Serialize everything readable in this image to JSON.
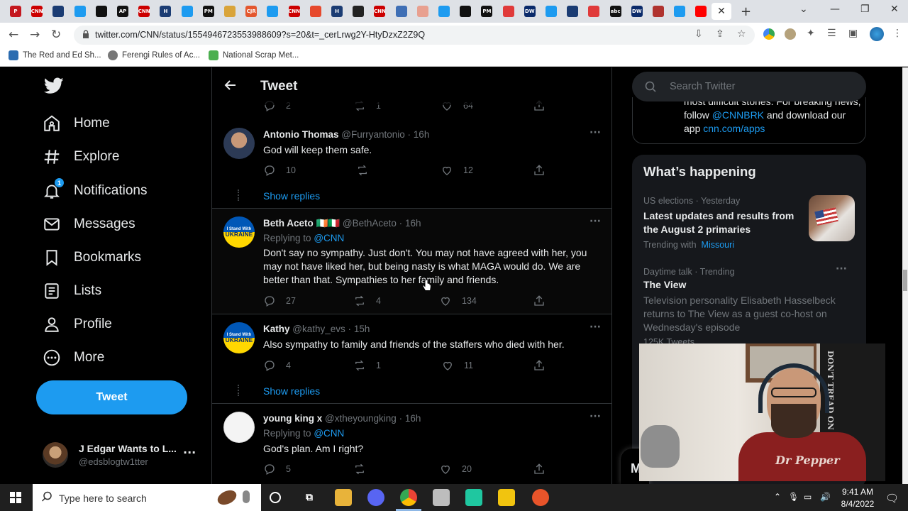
{
  "browser": {
    "url": "twitter.com/CNN/status/1554946723553988609?s=20&t=_cerLrwg2Y-HtyDzxZ2Z9Q",
    "tabs": [
      {
        "icon": "P",
        "color": "#c4181f"
      },
      {
        "icon": "CNN",
        "color": "#cc0000"
      },
      {
        "icon": "",
        "color": "#1b3c73"
      },
      {
        "icon": "",
        "color": "#1d9bf0"
      },
      {
        "icon": "",
        "color": "#111111"
      },
      {
        "icon": "AP",
        "color": "#111111"
      },
      {
        "icon": "CNN",
        "color": "#cc0000"
      },
      {
        "icon": "H",
        "color": "#1b3c73"
      },
      {
        "icon": "",
        "color": "#1d9bf0"
      },
      {
        "icon": "PM",
        "color": "#111111"
      },
      {
        "icon": "",
        "color": "#d9a43a"
      },
      {
        "icon": "CJR",
        "color": "#e4572e"
      },
      {
        "icon": "",
        "color": "#1d9bf0"
      },
      {
        "icon": "CNN",
        "color": "#cc0000"
      },
      {
        "icon": "",
        "color": "#e6492d"
      },
      {
        "icon": "H",
        "color": "#1b3c73"
      },
      {
        "icon": "",
        "color": "#222222"
      },
      {
        "icon": "CNN",
        "color": "#cc0000"
      },
      {
        "icon": "",
        "color": "#3f6fb5"
      },
      {
        "icon": "",
        "color": "#e8a090"
      },
      {
        "icon": "",
        "color": "#1d9bf0"
      },
      {
        "icon": "",
        "color": "#111111"
      },
      {
        "icon": "PM",
        "color": "#111111"
      },
      {
        "icon": "",
        "color": "#e03a3a"
      },
      {
        "icon": "DW",
        "color": "#0a2a6a"
      },
      {
        "icon": "",
        "color": "#1d9bf0"
      },
      {
        "icon": "",
        "color": "#1b3c73"
      },
      {
        "icon": "",
        "color": "#e03a3a"
      },
      {
        "icon": "abc",
        "color": "#111111"
      },
      {
        "icon": "DW",
        "color": "#0a2a6a"
      },
      {
        "icon": "",
        "color": "#b0332f"
      },
      {
        "icon": "",
        "color": "#1d9bf0"
      },
      {
        "icon": "",
        "color": "#ff0000"
      }
    ]
  },
  "bookmarks": [
    {
      "label": "The Red and Ed Sh...",
      "color": "#2b6cb0"
    },
    {
      "label": "Ferengi Rules of Ac...",
      "color": "#777777"
    },
    {
      "label": "National Scrap Met...",
      "color": "#4caf50"
    }
  ],
  "nav": {
    "items": [
      {
        "label": "Home",
        "icon": "home-icon"
      },
      {
        "label": "Explore",
        "icon": "hashtag-icon"
      },
      {
        "label": "Notifications",
        "icon": "bell-icon"
      },
      {
        "label": "Messages",
        "icon": "mail-icon"
      },
      {
        "label": "Bookmarks",
        "icon": "bookmark-icon"
      },
      {
        "label": "Lists",
        "icon": "list-icon"
      },
      {
        "label": "Profile",
        "icon": "person-icon"
      },
      {
        "label": "More",
        "icon": "more-circle-icon"
      }
    ],
    "notification_count": "1",
    "tweet_button": "Tweet",
    "account_name": "J Edgar Wants to L...",
    "account_handle": "@edsblogtw1tter"
  },
  "column": {
    "title": "Tweet",
    "top_stats": {
      "replies": "2",
      "retweets": "1",
      "likes": "64"
    }
  },
  "tweets": [
    {
      "name": "Antonio Thomas",
      "handle": "@Furryantonio",
      "time": "16h",
      "replying_to": "",
      "text": "God will keep them safe.",
      "replies": "10",
      "retweets": "",
      "likes": "12",
      "show_replies": "Show replies"
    },
    {
      "name": "Beth Aceto 🇮🇪🇮🇹",
      "handle": "@BethAceto",
      "time": "16h",
      "replying_to": "@CNN",
      "text": "Don't say no sympathy. Just don't. You may not have agreed with her, you may not have liked her, but being nasty is what MAGA would do. We are better than that. Sympathies to her family and friends.",
      "replies": "27",
      "retweets": "4",
      "likes": "134",
      "show_replies": ""
    },
    {
      "name": "Kathy",
      "handle": "@kathy_evs",
      "time": "15h",
      "replying_to": "",
      "text": "Also sympathy to family and friends of the staffers who died with her.",
      "replies": "4",
      "retweets": "1",
      "likes": "11",
      "show_replies": "Show replies"
    },
    {
      "name": "young king x",
      "handle": "@xtheyoungking",
      "time": "16h",
      "replying_to": "@CNN",
      "text": "God's plan. Am I right?",
      "replies": "5",
      "retweets": "",
      "likes": "20",
      "show_replies": ""
    }
  ],
  "replying_label": "Replying to",
  "ukraine_badge": {
    "line1": "I Stand With",
    "line2": "UKRAINE"
  },
  "right": {
    "search_placeholder": "Search Twitter",
    "promo": {
      "part1": "most difficult stories. For breaking news, follow",
      "link1": "@CNNBRK",
      "part2": "and download our app",
      "link2": "cnn.com/apps"
    },
    "whats_happening": "What’s happening",
    "trends": [
      {
        "meta": "US elections · Yesterday",
        "title": "Latest updates and results from the August 2 primaries",
        "trending_with_label": "Trending with",
        "trending_with": "Missouri"
      },
      {
        "meta": "Daytime talk · Trending",
        "title": "The View",
        "desc": "Television personality Elisabeth Hasselbeck returns to The View as a guest co-host on Wednesday's episode",
        "count": "125K Tweets"
      }
    ],
    "messages_drawer": "M"
  },
  "webcam": {
    "poster_text": "DON'T TREAD ON ME",
    "shirt_text": "Dr Pepper"
  },
  "taskbar": {
    "search_placeholder": "Type here to search",
    "time": "9:41 AM",
    "date": "8/4/2022"
  }
}
